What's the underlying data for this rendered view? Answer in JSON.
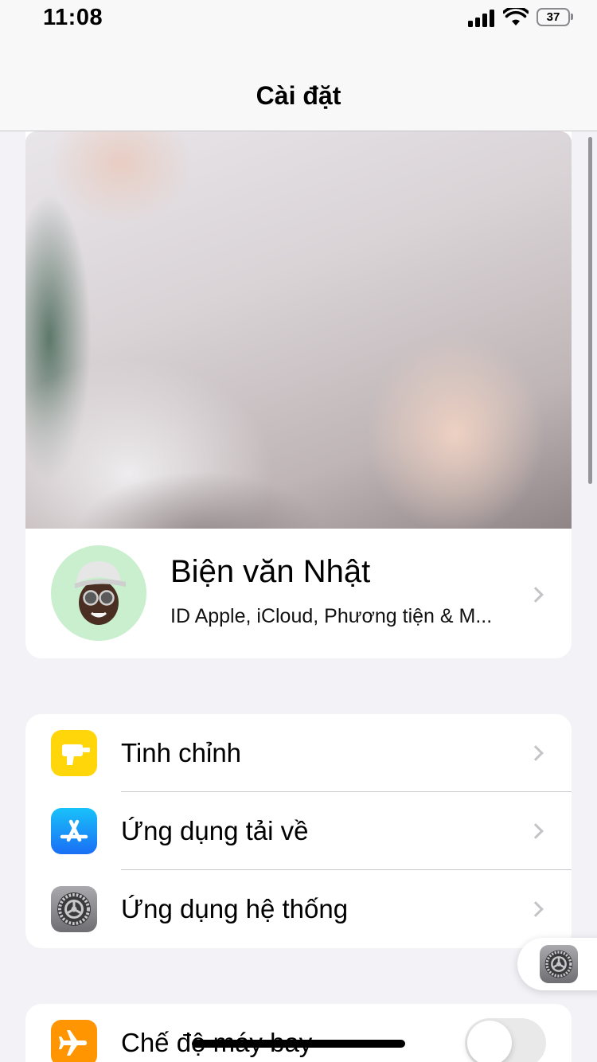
{
  "status_bar": {
    "time": "11:08",
    "signal_icon": "cellular-signal-icon",
    "wifi_icon": "wifi-icon",
    "battery_level": "37"
  },
  "nav": {
    "title": "Cài đặt"
  },
  "profile": {
    "name": "Biện văn Nhật",
    "subtitle": "ID Apple, iCloud, Phương tiện & M...",
    "avatar_icon": "memoji-avatar-icon",
    "cover_photo": "profile-cover-photo"
  },
  "group1": {
    "items": [
      {
        "label": "Tinh chỉnh",
        "icon": "drill-icon",
        "color": "#ffd60a"
      },
      {
        "label": "Ứng dụng tải về",
        "icon": "app-store-icon",
        "color": "#1c8ef9"
      },
      {
        "label": "Ứng dụng hệ thống",
        "icon": "gear-icon",
        "color": "#8e8e93"
      }
    ]
  },
  "group2": {
    "items": [
      {
        "label": "Chế độ máy bay",
        "icon": "airplane-icon",
        "color": "#ff9500",
        "toggle_on": false
      }
    ]
  },
  "floating": {
    "icon": "settings-gear-icon"
  }
}
